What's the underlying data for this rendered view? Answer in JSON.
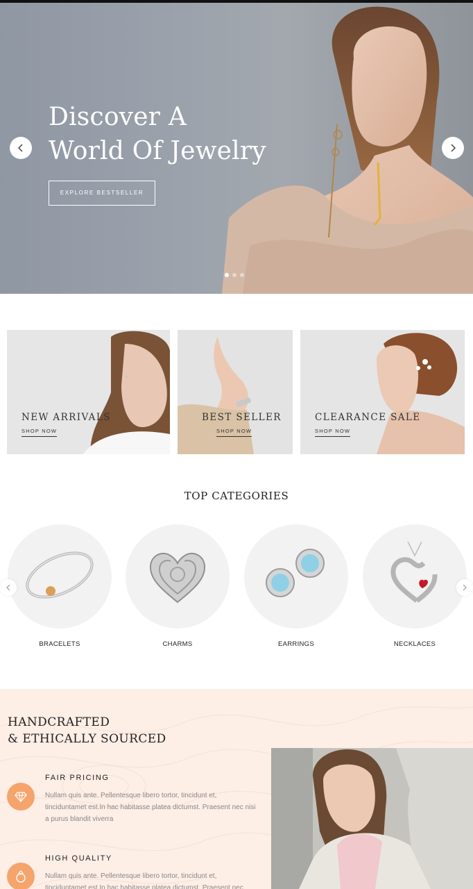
{
  "hero": {
    "title_line1": "Discover A",
    "title_line2": "World Of Jewelry",
    "button_label": "EXPLORE BESTSELLER",
    "slide_count": 3,
    "active_slide": 1
  },
  "banners": [
    {
      "title": "NEW ARRIVALS",
      "link": "SHOP NOW"
    },
    {
      "title": "BEST SELLER",
      "link": "SHOP NOW"
    },
    {
      "title": "CLEARANCE SALE",
      "link": "SHOP NOW"
    }
  ],
  "categories": {
    "title": "TOP CATEGORIES",
    "items": [
      {
        "label": "BRACELETS",
        "icon": "bracelet-icon"
      },
      {
        "label": "CHARMS",
        "icon": "heart-charm-icon"
      },
      {
        "label": "EARRINGS",
        "icon": "earrings-icon"
      },
      {
        "label": "NECKLACES",
        "icon": "heart-necklace-icon"
      }
    ]
  },
  "handcrafted": {
    "title_line1": "HANDCRAFTED",
    "title_line2": "& ETHICALLY SOURCED",
    "features": [
      {
        "heading": "FAIR PRICING",
        "text": "Nullam quis ante. Pellentesque libero tortor, tincidunt et, tinciduntamet est.In hac habitasse platea dictumst. Praesent nec nisi a purus blandit viverra",
        "icon": "diamond-icon"
      },
      {
        "heading": "HIGH QUALITY",
        "text": "Nullam quis ante. Pellentesque libero tortor, tincidunt et, tinciduntamet est.In hac habitasse platea dictumst. Praesent nec",
        "icon": "ring-icon"
      }
    ]
  },
  "colors": {
    "accent": "#f5a46c",
    "section_bg": "#fdeee6"
  }
}
